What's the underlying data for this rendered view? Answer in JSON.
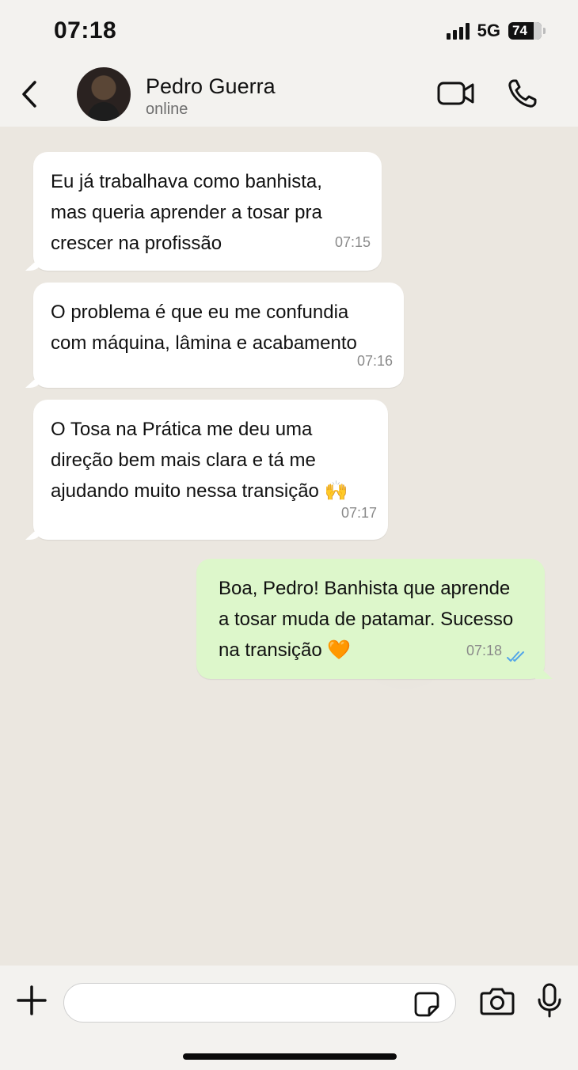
{
  "status_bar": {
    "time": "07:18",
    "network": "5G",
    "battery": "74"
  },
  "header": {
    "contact_name": "Pedro Guerra",
    "contact_status": "online",
    "icons": [
      "back-chevron-icon",
      "video-call-icon",
      "phone-call-icon"
    ]
  },
  "messages": [
    {
      "direction": "incoming",
      "text": "Eu já trabalhava como banhista,\nmas queria aprender a tosar pra\ncrescer na profissão",
      "time": "07:15"
    },
    {
      "direction": "incoming",
      "text": "O problema é que eu me confundia\ncom máquina, lâmina e acabamento",
      "time": "07:16"
    },
    {
      "direction": "incoming",
      "text": "O Tosa na Prática me deu uma\ndireção bem mais clara e tá me\najudando muito nessa transição 🙌",
      "time": "07:17"
    },
    {
      "direction": "outgoing",
      "text": "Boa, Pedro! Banhista que aprende\na tosar muda de patamar. Sucesso\nna transição 🧡",
      "time": "07:18",
      "read": true
    }
  ],
  "composer": {
    "placeholder": "",
    "icons": [
      "plus-icon",
      "sticker-icon",
      "camera-icon",
      "microphone-icon"
    ]
  },
  "colors": {
    "outgoing_bubble": "#ddf7cb",
    "incoming_bubble": "#ffffff",
    "read_ticks": "#53a6e8",
    "chat_background": "#ebe7e0"
  }
}
